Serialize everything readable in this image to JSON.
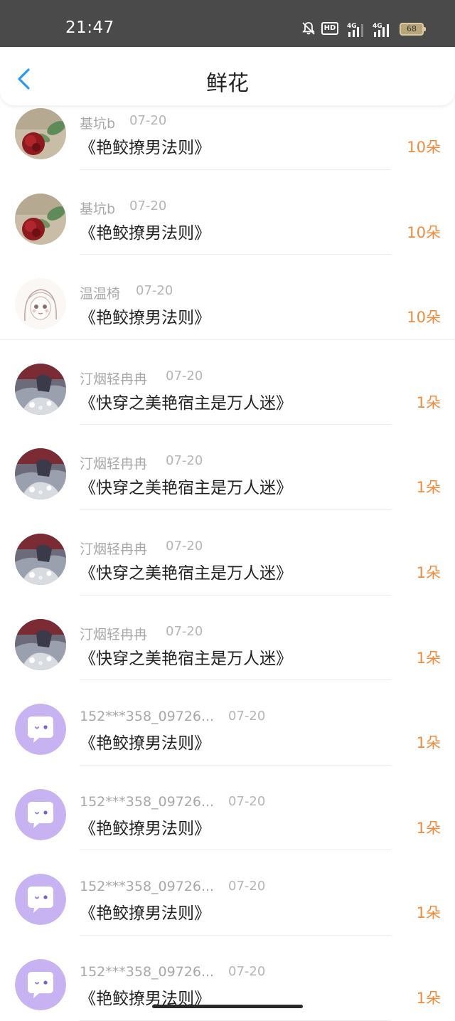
{
  "status_bar": {
    "time": "21:47",
    "hd_label": "HD",
    "signal_1_label": "4G",
    "signal_2_label": "4G",
    "battery": "68",
    "icons": [
      "bell-off-icon",
      "hd-icon",
      "signal-4g-icon",
      "signal-4g-icon",
      "battery-icon"
    ]
  },
  "header": {
    "title": "鲜花",
    "back_icon": "chevron-left-icon"
  },
  "colors": {
    "accent_blue": "#2b9af3",
    "count_orange": "#f08a3c",
    "default_avatar_purple": "#c7b3f2"
  },
  "flowers": [
    {
      "name": "基坑b",
      "date": "07-20",
      "book": "《艳鲛撩男法则》",
      "count": "10朵",
      "avatar": "rose-photo"
    },
    {
      "name": "基坑b",
      "date": "07-20",
      "book": "《艳鲛撩男法则》",
      "count": "10朵",
      "avatar": "rose-photo"
    },
    {
      "name": "温温椅",
      "date": "07-20",
      "book": "《艳鲛撩男法则》",
      "count": "10朵",
      "avatar": "sketch-girl"
    },
    {
      "name": "汀烟轻冉冉",
      "date": "07-20",
      "book": "《快穿之美艳宿主是万人迷》",
      "count": "1朵",
      "avatar": "anime-girl"
    },
    {
      "name": "汀烟轻冉冉",
      "date": "07-20",
      "book": "《快穿之美艳宿主是万人迷》",
      "count": "1朵",
      "avatar": "anime-girl"
    },
    {
      "name": "汀烟轻冉冉",
      "date": "07-20",
      "book": "《快穿之美艳宿主是万人迷》",
      "count": "1朵",
      "avatar": "anime-girl"
    },
    {
      "name": "汀烟轻冉冉",
      "date": "07-20",
      "book": "《快穿之美艳宿主是万人迷》",
      "count": "1朵",
      "avatar": "anime-girl"
    },
    {
      "name": "152***358_09726...",
      "date": "07-20",
      "book": "《艳鲛撩男法则》",
      "count": "1朵",
      "avatar": "default-chat"
    },
    {
      "name": "152***358_09726...",
      "date": "07-20",
      "book": "《艳鲛撩男法则》",
      "count": "1朵",
      "avatar": "default-chat"
    },
    {
      "name": "152***358_09726...",
      "date": "07-20",
      "book": "《艳鲛撩男法则》",
      "count": "1朵",
      "avatar": "default-chat"
    },
    {
      "name": "152***358_09726...",
      "date": "07-20",
      "book": "《艳鲛撩男法则》",
      "count": "1朵",
      "avatar": "default-chat"
    }
  ]
}
